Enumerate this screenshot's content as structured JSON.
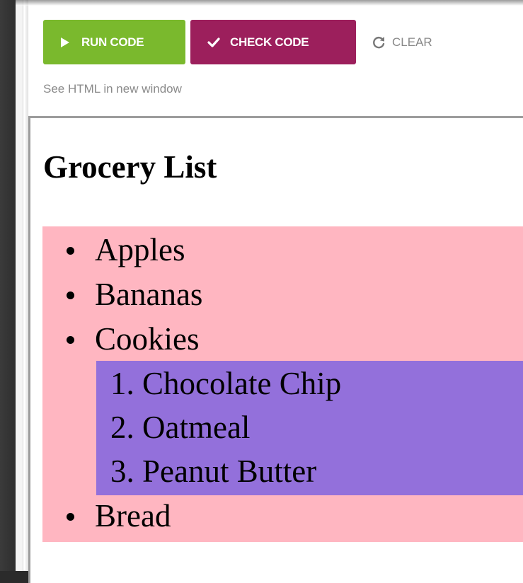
{
  "toolbar": {
    "run_label": "RUN CODE",
    "check_label": "CHECK CODE",
    "clear_label": "CLEAR"
  },
  "links": {
    "new_window": "See HTML in new window"
  },
  "preview": {
    "heading": "Grocery List",
    "items": [
      "Apples",
      "Bananas",
      "Cookies",
      "Bread"
    ],
    "sub_items": [
      "1. Chocolate Chip",
      "2. Oatmeal",
      "3. Peanut Butter"
    ]
  },
  "colors": {
    "run_button": "#7ab92d",
    "check_button": "#9c1f5c",
    "list_background": "#ffb6c1",
    "sublist_background": "#9370db"
  },
  "icons": {
    "run": "play-icon",
    "check": "checkmark-icon",
    "clear": "refresh-icon"
  }
}
